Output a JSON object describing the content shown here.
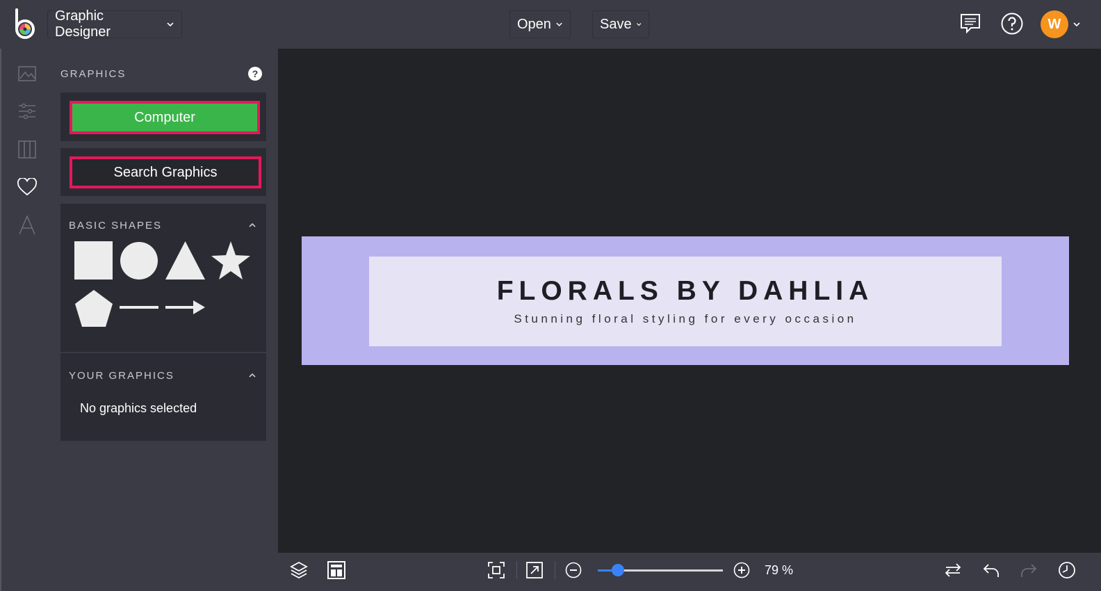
{
  "colors": {
    "topbar_bg": "#3a3b44",
    "canvas_bg": "#222327",
    "accent_green": "#3ab54a",
    "highlight_pink": "#e4185b",
    "avatar_orange": "#f7941d",
    "banner_outer": "#b8b3ee",
    "banner_inner": "#e6e3f4",
    "slider_blue": "#3a82f7"
  },
  "topbar": {
    "app_name": "Graphic Designer",
    "open_label": "Open",
    "save_label": "Save",
    "avatar_initial": "W",
    "icons": [
      "comments-icon",
      "help-icon",
      "chevron-down-icon"
    ]
  },
  "rail": {
    "icons": [
      "image-icon",
      "sliders-icon",
      "columns-icon",
      "heart-icon",
      "text-icon"
    ]
  },
  "panel": {
    "title": "GRAPHICS",
    "help_glyph": "?",
    "computer_label": "Computer",
    "search_label": "Search Graphics",
    "basic_shapes_title": "BASIC SHAPES",
    "shapes": [
      "square",
      "circle",
      "triangle",
      "star",
      "pentagon",
      "line",
      "arrow"
    ],
    "your_graphics_title": "YOUR GRAPHICS",
    "no_graphics_text": "No graphics selected"
  },
  "canvas": {
    "title": "FLORALS BY DAHLIA",
    "subtitle": "Stunning floral styling for every occasion"
  },
  "bottombar": {
    "zoom_text": "79 %",
    "zoom_fraction": 0.16,
    "icons": [
      "layers-icon",
      "layout-icon",
      "fit-screen-icon",
      "expand-icon",
      "zoom-out-icon",
      "zoom-in-icon",
      "swap-icon",
      "undo-icon",
      "redo-icon",
      "history-icon"
    ]
  }
}
